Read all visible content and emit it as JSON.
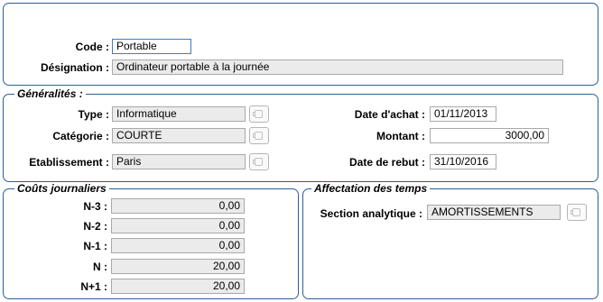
{
  "header": {
    "code_label": "Code :",
    "code_value": "Portable",
    "designation_label": "Désignation :",
    "designation_value": "Ordinateur portable à la journée"
  },
  "generalites": {
    "title": "Généralités :",
    "type_label": "Type :",
    "type_value": "Informatique",
    "categorie_label": "Catégorie :",
    "categorie_value": "COURTE",
    "etablissement_label": "Etablissement :",
    "etablissement_value": "Paris",
    "date_achat_label": "Date d'achat :",
    "date_achat_value": "01/11/2013",
    "montant_label": "Montant :",
    "montant_value": "3000,00",
    "date_rebut_label": "Date de rebut :",
    "date_rebut_value": "31/10/2016",
    "lookup_icon": "lookup-icon"
  },
  "couts": {
    "title": "Coûts journaliers",
    "rows": [
      {
        "label": "N-3 :",
        "value": "0,00"
      },
      {
        "label": "N-2 :",
        "value": "0,00"
      },
      {
        "label": "N-1 :",
        "value": "0,00"
      },
      {
        "label": "N :",
        "value": "20,00"
      },
      {
        "label": "N+1 :",
        "value": "20,00"
      }
    ]
  },
  "affectation": {
    "title": "Affectation des temps",
    "section_label": "Section analytique :",
    "section_value": "AMORTISSEMENTS"
  }
}
